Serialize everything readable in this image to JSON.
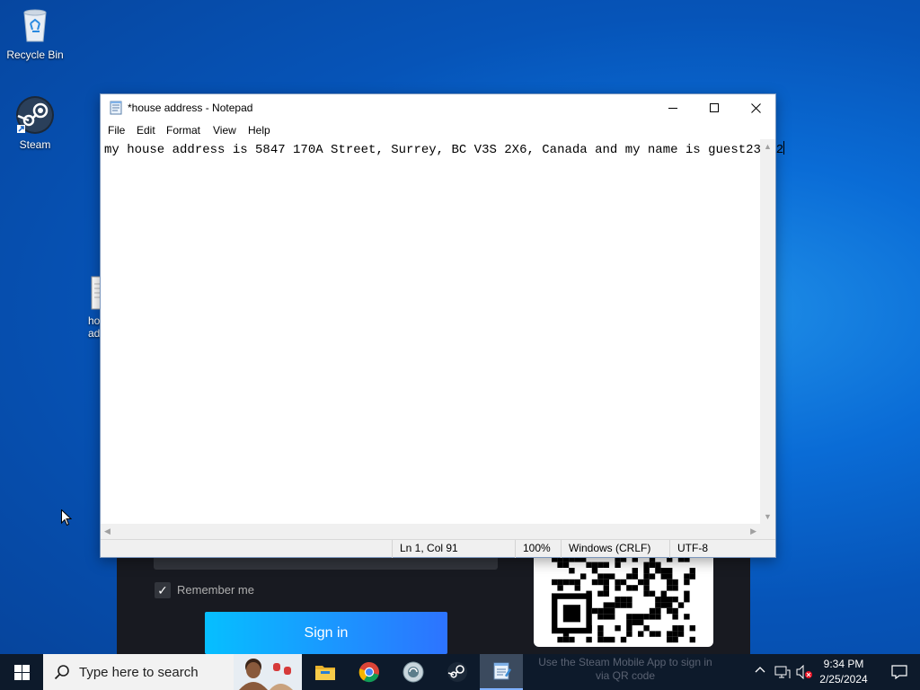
{
  "desktop": {
    "icons": [
      {
        "label": "Recycle Bin",
        "icon": "recycle-bin-icon"
      },
      {
        "label": "Steam",
        "icon": "steam-icon"
      },
      {
        "label": "house address",
        "icon": "text-file-icon"
      }
    ]
  },
  "steam_login": {
    "remember_label": "Remember me",
    "remember_checked": true,
    "signin_label": "Sign in",
    "qr_hint": "Use the Steam Mobile App to sign in via QR code",
    "signin_colors": [
      "#06bfff",
      "#2d73ff"
    ]
  },
  "notepad": {
    "title": "*house address - Notepad",
    "menu": [
      "File",
      "Edit",
      "Format",
      "View",
      "Help"
    ],
    "content": "my house address is 5847 170A Street, Surrey, BC V3S 2X6, Canada and my name is guest23722",
    "status": {
      "position": "Ln 1, Col 91",
      "zoom": "100%",
      "line_ending": "Windows (CRLF)",
      "encoding": "UTF-8"
    }
  },
  "taskbar": {
    "search_placeholder": "Type here to search",
    "apps": [
      "file-explorer-icon",
      "chrome-icon",
      "agent-icon",
      "steam-icon",
      "notepad-icon"
    ],
    "active_app": "notepad-icon",
    "clock": {
      "time": "9:34 PM",
      "date": "2/25/2024"
    }
  }
}
